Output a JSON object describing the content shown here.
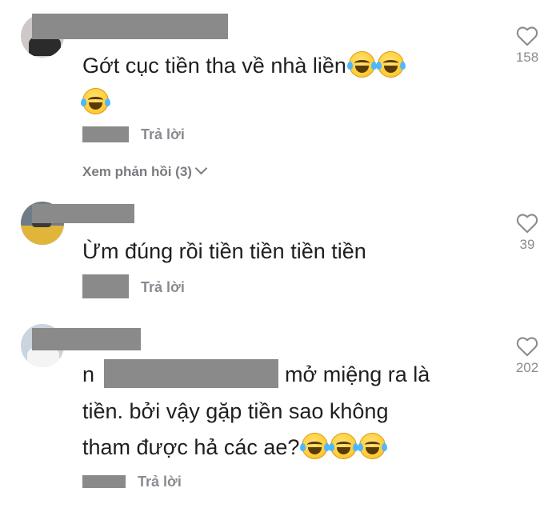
{
  "comments": [
    {
      "text": "Gớt cục tiền tha về nhà liền",
      "reply_label": "Trả lời",
      "view_replies": "Xem phản hồi (3)",
      "likes": "158"
    },
    {
      "text": "Ừm đúng rồi tiền tiền tiền tiền",
      "reply_label": "Trả lời",
      "likes": "39"
    },
    {
      "text_line1_visible": "n",
      "text_line1_rest": "mở miệng ra là",
      "text_line2": "tiền. bởi vậy gặp tiền sao không",
      "text_line3": "tham được hả các ae?",
      "reply_label": "Trả lời",
      "likes": "202"
    }
  ],
  "icons": {
    "like": "heart-outline-icon",
    "emoji": "tears-of-joy-emoji"
  },
  "colors": {
    "text": "#1f1f1f",
    "meta": "#8a8b91",
    "redaction": "#8a8a8a"
  }
}
